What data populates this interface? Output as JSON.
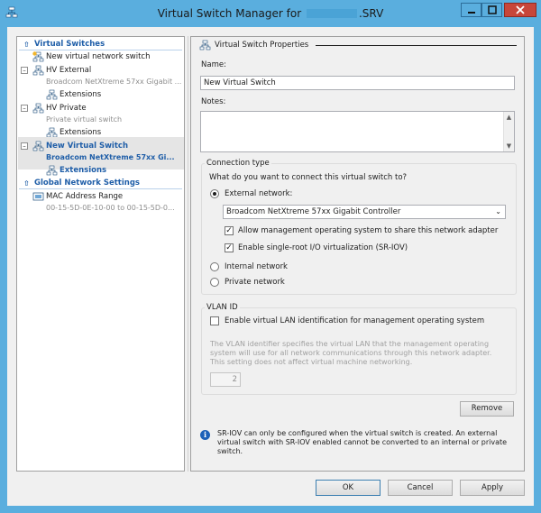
{
  "window": {
    "title_prefix": "Virtual Switch Manager for",
    "title_suffix": ".SRV",
    "controls": {
      "minimize": "minimize",
      "maximize": "maximize",
      "close": "close"
    }
  },
  "nav": {
    "virtual_switches_header": "Virtual Switches",
    "new_switch_link": "New virtual network switch",
    "switches": [
      {
        "name": "HV External",
        "detail": "Broadcom NetXtreme 57xx Gigabit ...",
        "child": "Extensions"
      },
      {
        "name": "HV Private",
        "detail": "Private virtual switch",
        "child": "Extensions"
      },
      {
        "name": "New Virtual Switch",
        "detail": "Broadcom NetXtreme 57xx Gi...",
        "child": "Extensions"
      }
    ],
    "global_header": "Global Network Settings",
    "mac": {
      "name": "MAC Address Range",
      "detail": "00-15-5D-0E-10-00 to 00-15-5D-0..."
    }
  },
  "props": {
    "section_title": "Virtual Switch Properties",
    "name_label": "Name:",
    "name_value": "New Virtual Switch",
    "notes_label": "Notes:",
    "notes_value": "",
    "connection": {
      "group_label": "Connection type",
      "question": "What do you want to connect this virtual switch to?",
      "external_label": "External network:",
      "adapter_selected": "Broadcom NetXtreme 57xx Gigabit Controller",
      "allow_mgmt_label": "Allow management operating system to share this network adapter",
      "sriov_label": "Enable single-root I/O virtualization (SR-IOV)",
      "internal_label": "Internal network",
      "private_label": "Private network"
    },
    "vlan": {
      "group_label": "VLAN ID",
      "enable_label": "Enable virtual LAN identification for management operating system",
      "description": "The VLAN identifier specifies the virtual LAN that the management operating system will use for all network communications through this network adapter. This setting does not affect virtual machine networking.",
      "value": "2"
    },
    "remove_label": "Remove",
    "info_text": "SR-IOV can only be configured when the virtual switch is created. An external virtual switch with SR-IOV enabled cannot be converted to an internal or private switch."
  },
  "footer": {
    "ok_label": "OK",
    "cancel_label": "Cancel",
    "apply_label": "Apply"
  },
  "icons": {
    "app": "network-switch-icon",
    "switch": "network-switch-icon",
    "extensions": "extensions-icon",
    "new": "new-switch-icon"
  }
}
